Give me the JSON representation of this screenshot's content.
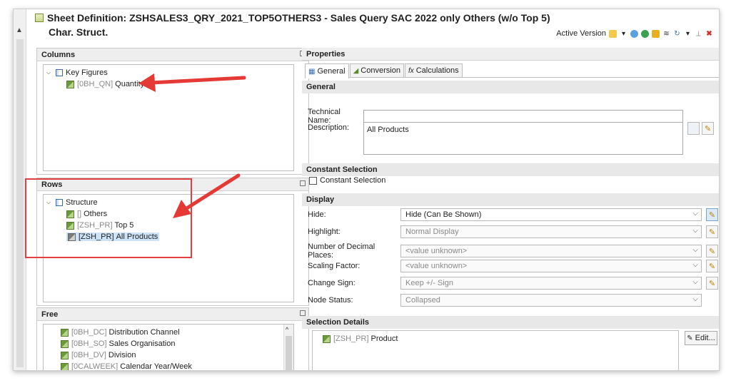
{
  "header": {
    "title": "Sheet Definition: ZSHSALES3_QRY_2021_TOP5OTHERS3 - Sales Query SAC 2022 only Others (w/o Top 5)",
    "subtitle": "Char. Struct.",
    "active_version_label": "Active Version"
  },
  "columns": {
    "heading": "Columns",
    "root": "Key Figures",
    "items": [
      {
        "tech": "[0BH_QN]",
        "name": "Quantity"
      }
    ]
  },
  "rows": {
    "heading": "Rows",
    "root": "Structure",
    "items": [
      {
        "tech": "[]",
        "name": "Others"
      },
      {
        "tech": "[ZSH_PR]",
        "name": "Top 5"
      },
      {
        "tech": "[ZSH_PR]",
        "name": "All Products"
      }
    ]
  },
  "free": {
    "heading": "Free",
    "items": [
      {
        "tech": "[0BH_DC]",
        "name": "Distribution Channel"
      },
      {
        "tech": "[0BH_SO]",
        "name": "Sales Organisation"
      },
      {
        "tech": "[0BH_DV]",
        "name": "Division"
      },
      {
        "tech": "[0CALWEEK]",
        "name": "Calendar Year/Week"
      }
    ]
  },
  "properties": {
    "heading": "Properties",
    "tabs": [
      "General",
      "Conversion",
      "Calculations"
    ],
    "general_heading": "General",
    "technical_name_label": "Technical Name:",
    "technical_name_value": "",
    "description_label": "Description:",
    "description_value": "All Products",
    "constant_heading": "Constant Selection",
    "constant_checkbox_label": "Constant Selection",
    "display_heading": "Display",
    "display_rows": [
      {
        "label": "Hide:",
        "value": "Hide (Can Be Shown)"
      },
      {
        "label": "Highlight:",
        "value": "Normal Display"
      },
      {
        "label": "Number of Decimal Places:",
        "value": "<value unknown>"
      },
      {
        "label": "Scaling Factor:",
        "value": "<value unknown>"
      },
      {
        "label": "Change Sign:",
        "value": "Keep +/- Sign"
      },
      {
        "label": "Node Status:",
        "value": "Collapsed"
      }
    ],
    "selection_heading": "Selection Details",
    "selection_item": {
      "tech": "[ZSH_PR]",
      "name": "Product"
    },
    "edit_button": "Edit..."
  },
  "colors": {
    "arrow": "#e53935",
    "highlight_box": "#e04040",
    "selected": "#cde3f7"
  }
}
